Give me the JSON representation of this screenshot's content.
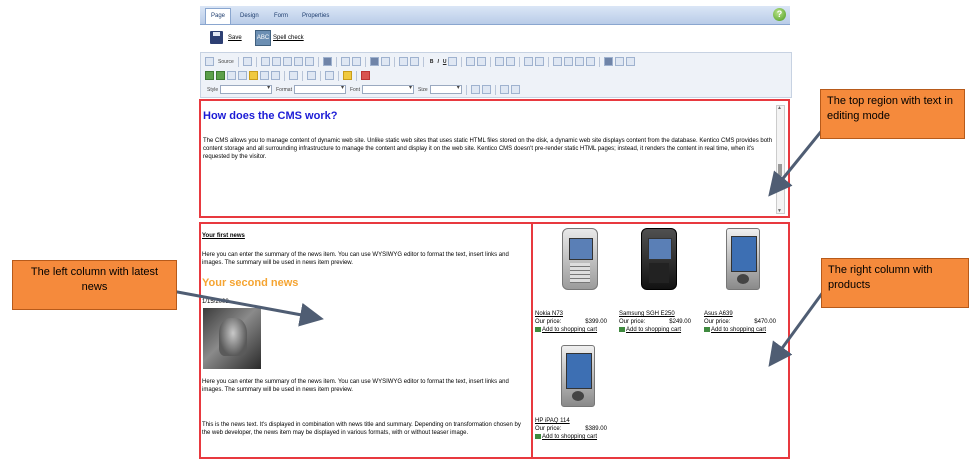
{
  "tabs": [
    "Page",
    "Design",
    "Form",
    "Properties"
  ],
  "help_icon": "?",
  "savebar": {
    "save_label": "Save",
    "spellcheck_label": "Spell check"
  },
  "toolbar": {
    "source_label": "Source",
    "style_label": "Style",
    "format_label": "Format",
    "font_label": "Font",
    "size_label": "Size",
    "bold": "B",
    "italic": "I",
    "underline": "U"
  },
  "top_region": {
    "heading": "How does the CMS work?",
    "body": "The CMS allows you to manage content of dynamic web site. Unlike static web sites that uses static HTML files stored on the disk, a dynamic web site displays content from the database. Kentico CMS provides both content storage and all surrounding infrastructure to manage the content and display it on the web site. Kentico CMS doesn't pre-render static HTML pages; instead, it renders the content in real time, when it's requested by the visitor."
  },
  "left_region": {
    "first_news_title": "Your first news",
    "first_news_text": "Here you can enter the summary of the news item. You can use WYSIWYG editor to format the text, insert links and images. The summary will be used in news item preview.",
    "second_news_title": "Your second news",
    "second_news_date": "1/15/2008",
    "second_news_summary": "Here you can enter the summary of the news item. You can use WYSIWYG editor to format the text, insert links and images. The summary will be used in news item preview.",
    "second_news_body": "This is the news text. It's displayed in combination with news title and summary. Depending on transformation chosen by the web developer, the news item may be displayed in various formats, with or without teaser image."
  },
  "right_region": {
    "price_label": "Our price:",
    "cart_label": "Add to shopping cart",
    "products": [
      {
        "name": "Nokia N73",
        "price": "$399.00",
        "icon": "phone-silver"
      },
      {
        "name": "Samsung SGH E250",
        "price": "$249.00",
        "icon": "phone-black-slider"
      },
      {
        "name": "Asus A639",
        "price": "$470.00",
        "icon": "pda"
      },
      {
        "name": "HP iPAQ 114",
        "price": "$389.00",
        "icon": "pda"
      }
    ]
  },
  "callouts": {
    "top": "The top region with text in editing mode",
    "left": "The left column with latest news",
    "right": "The right column with products"
  },
  "colors": {
    "region_border": "#e8393f",
    "callout_fill": "#f58a3c",
    "heading_blue": "#1b1bd6",
    "heading_orange": "#f5a431",
    "arrow": "#4f5d73"
  }
}
